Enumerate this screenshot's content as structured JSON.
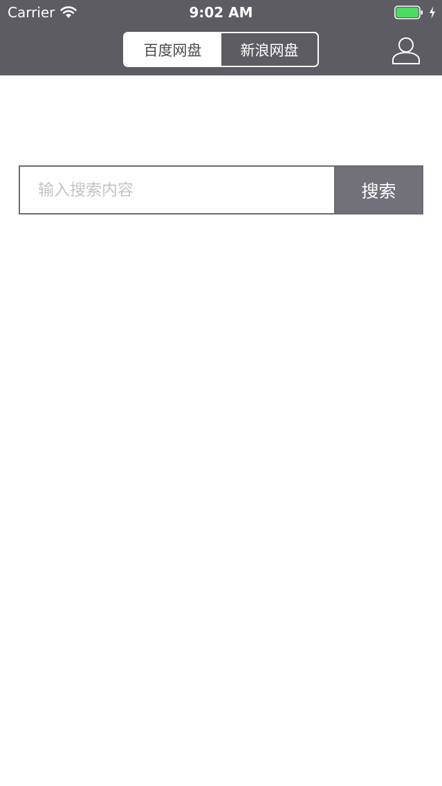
{
  "status_bar": {
    "carrier": "Carrier",
    "time": "9:02 AM",
    "wifi_icon": "wifi-icon",
    "battery_icon": "battery-icon",
    "battery_level": 1.0,
    "charging_icon": "charging-bolt-icon"
  },
  "nav": {
    "segments": [
      {
        "label": "百度网盘",
        "selected": true
      },
      {
        "label": "新浪网盘",
        "selected": false
      }
    ],
    "profile_icon": "user-profile-icon"
  },
  "search": {
    "placeholder": "输入搜索内容",
    "value": "",
    "button_label": "搜索"
  },
  "colors": {
    "header_bg": "#5d5c63",
    "button_bg": "#727078",
    "battery_green": "#4cd964",
    "page_bg": "#ffffff"
  }
}
